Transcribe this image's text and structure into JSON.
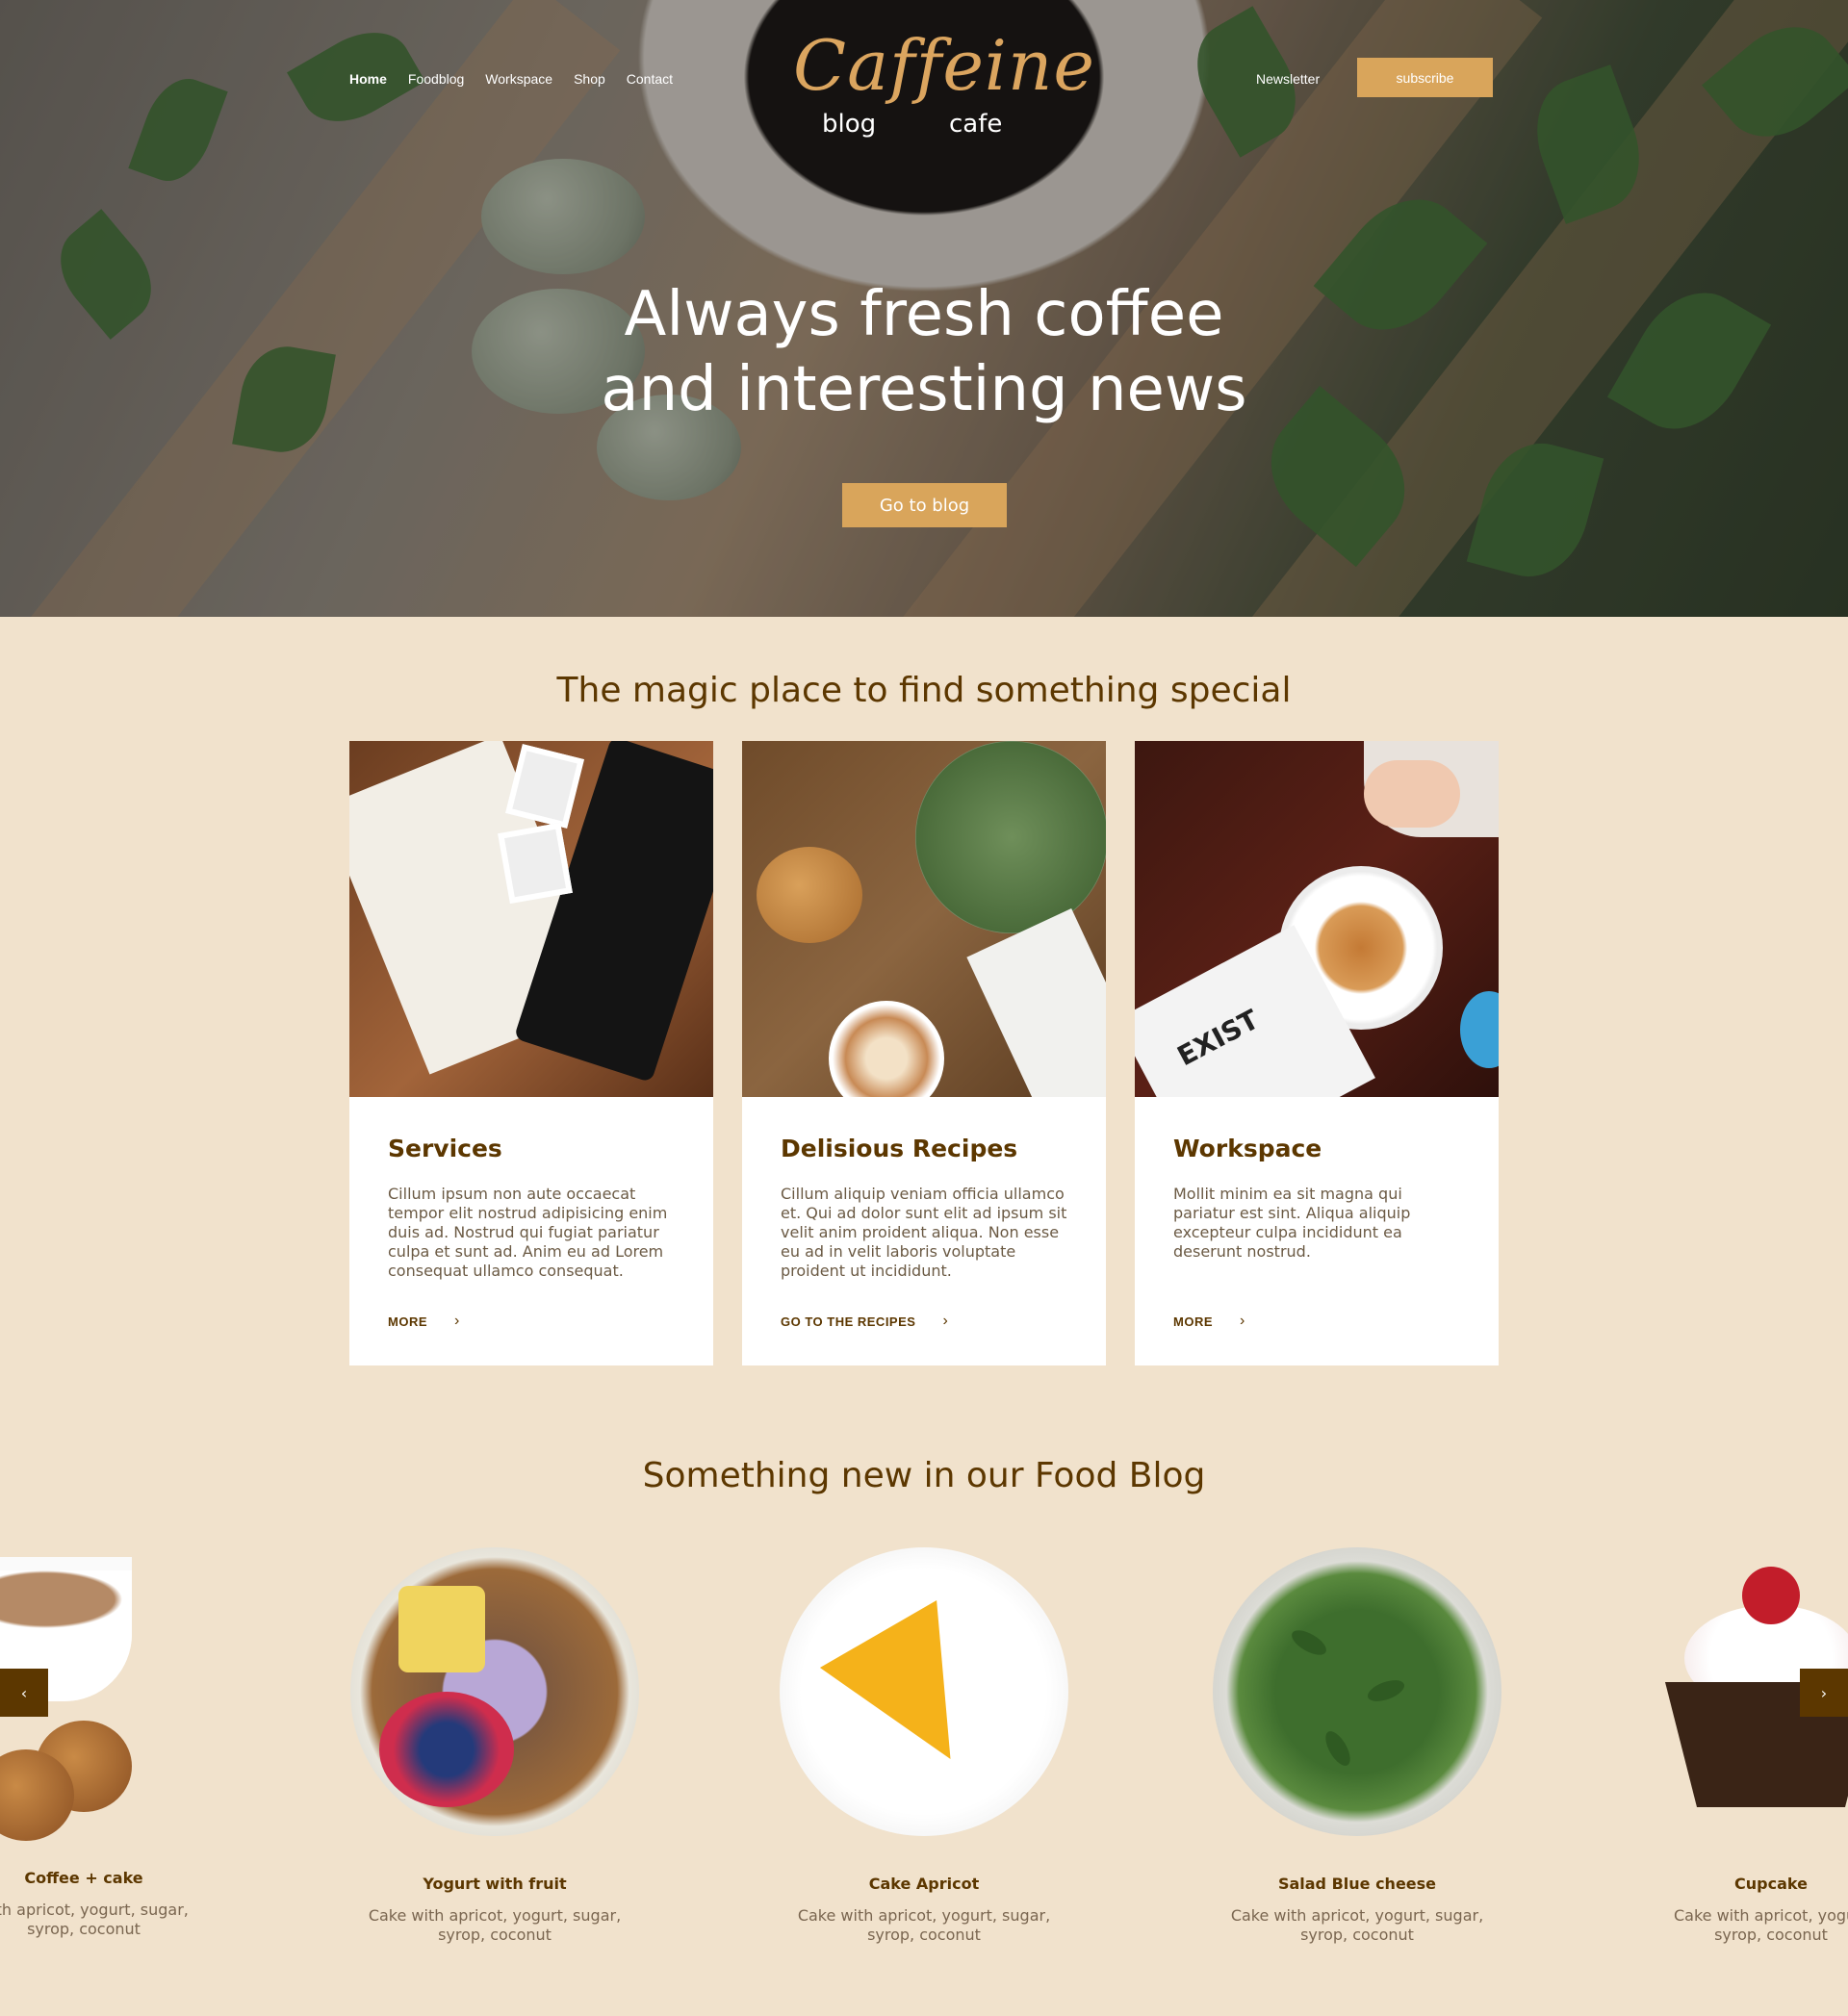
{
  "nav": {
    "items": [
      "Home",
      "Foodblog",
      "Workspace",
      "Shop",
      "Contact"
    ],
    "active": "Home"
  },
  "logo": {
    "word": "Caffeine",
    "left": "blog",
    "right": "cafe"
  },
  "header": {
    "newsletter": "Newsletter",
    "subscribe": "subscribe"
  },
  "hero": {
    "line1": "Always fresh coffee",
    "line2": "and interesting news",
    "cta": "Go to blog"
  },
  "features": {
    "title": "The magic place to find something special",
    "cards": [
      {
        "title": "Services",
        "text": "Cillum ipsum non aute occaecat tempor elit nostrud adipisicing enim duis ad. Nostrud qui fugiat pariatur culpa et sunt ad. Anim eu ad Lorem consequat ullamco consequat.",
        "link": "MORE"
      },
      {
        "title": "Delisious  Recipes",
        "text": "Cillum aliquip veniam officia ullamco et. Qui ad dolor sunt elit ad ipsum sit velit anim proident aliqua. Non esse eu ad in velit laboris voluptate proident ut incididunt.",
        "link": "GO TO THE RECIPES"
      },
      {
        "title": "Workspace",
        "text": "Mollit minim ea sit magna qui pariatur est sint. Aliqua aliquip excepteur culpa incididunt ea deserunt nostrud.",
        "link": "MORE"
      }
    ]
  },
  "blog": {
    "title": "Something new in our Food Blog",
    "items": [
      {
        "title": "Coffee + cake",
        "line1": "with apricot, yogurt, sugar,",
        "line2": "syrop, coconut"
      },
      {
        "title": "Yogurt with fruit",
        "line1": "Cake with apricot, yogurt, sugar,",
        "line2": "syrop, coconut"
      },
      {
        "title": "Cake Apricot",
        "line1": "Cake with apricot, yogurt, sugar,",
        "line2": "syrop, coconut"
      },
      {
        "title": "Salad Blue cheese",
        "line1": "Cake with apricot, yogurt, sugar,",
        "line2": "syrop, coconut"
      },
      {
        "title": "Cupcake",
        "line1": "Cake with apricot, yogurt",
        "line2": "syrop, coconut"
      }
    ],
    "prev": "‹",
    "next": "›"
  },
  "colors": {
    "accent": "#d9a55b",
    "brown": "#5c3700",
    "background": "#f1e2cc"
  },
  "icons": [
    "chevron-right-icon",
    "chevron-left-icon"
  ]
}
